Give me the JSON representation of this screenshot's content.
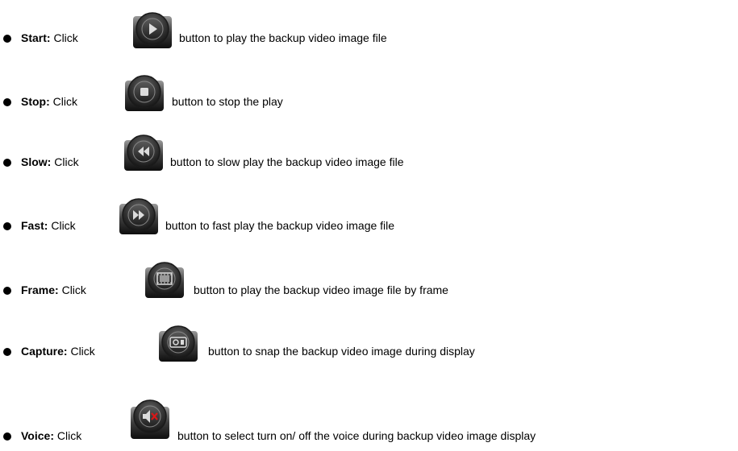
{
  "items": [
    {
      "term": "Start:",
      "click": "Click",
      "desc": "button to play the backup video image file",
      "icon": "play-icon"
    },
    {
      "term": "Stop:",
      "click": "Click",
      "desc": "button to stop the play",
      "icon": "stop-icon"
    },
    {
      "term": "Slow:",
      "click": "Click",
      "desc": "button to slow play the backup video image file",
      "icon": "rewind-icon"
    },
    {
      "term": "Fast:",
      "click": "Click",
      "desc": "button to fast play the backup video image file",
      "icon": "fast-forward-icon"
    },
    {
      "term": "Frame:",
      "click": "Click",
      "desc": "button to play the backup video image file by frame",
      "icon": "film-frame-icon"
    },
    {
      "term": "Capture:",
      "click": "Click",
      "desc": "button to snap the backup video image during display",
      "icon": "camera-capture-icon"
    },
    {
      "term": "Voice:",
      "click": "Click",
      "desc": "button to select turn on/ off the voice during backup video image display",
      "icon": "speaker-mute-icon"
    }
  ],
  "colors": {
    "text": "#000000",
    "button_outer": "#2b2b2b",
    "button_inner": "#4a4a4a",
    "glyph": "#d8d8d8",
    "mute_cross": "#d81818"
  }
}
